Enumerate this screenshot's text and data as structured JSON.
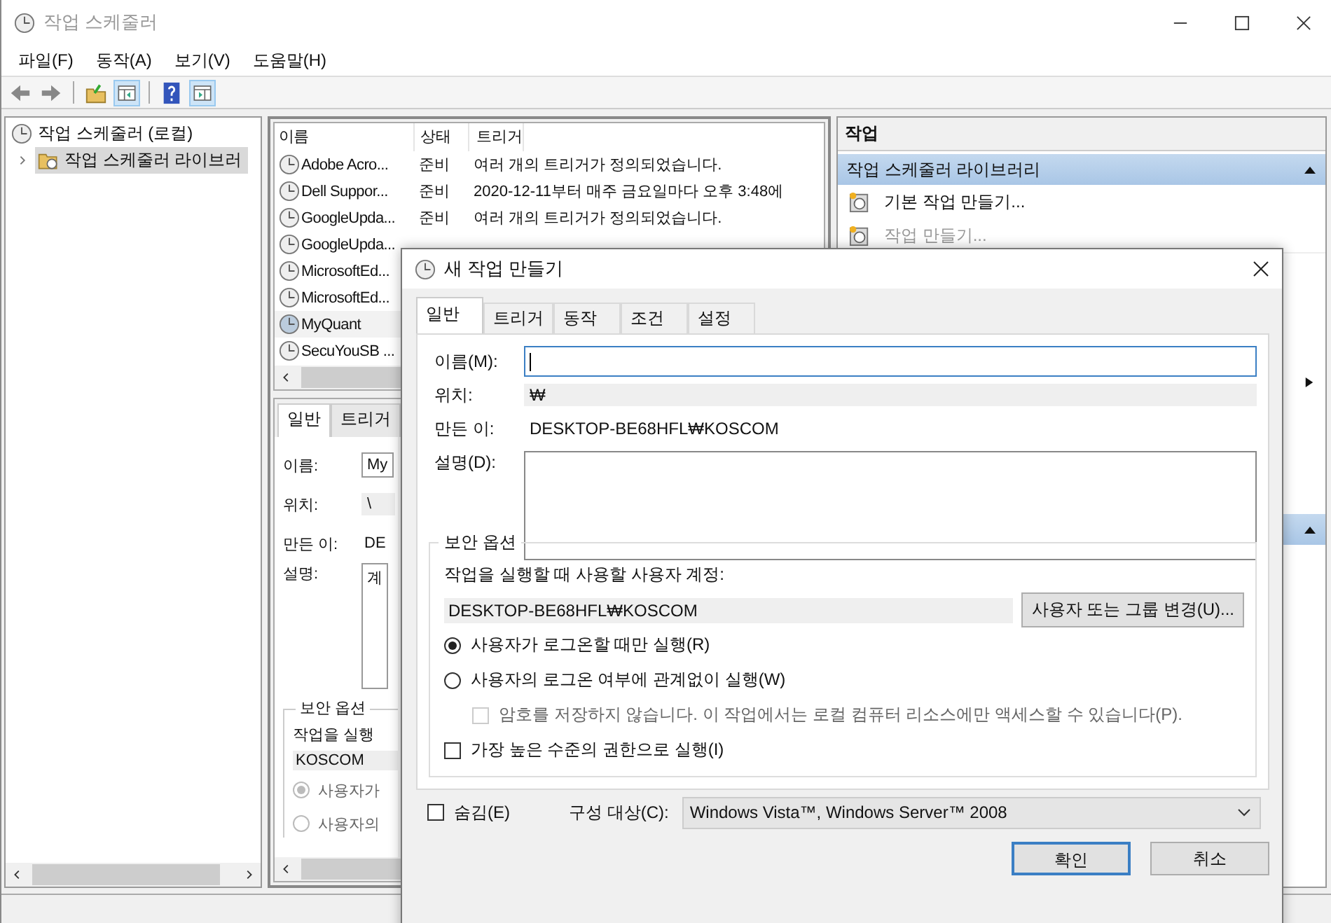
{
  "window": {
    "title": "작업 스케줄러"
  },
  "menu": [
    "파일(F)",
    "동작(A)",
    "보기(V)",
    "도움말(H)"
  ],
  "tree": [
    {
      "label": "작업 스케줄러 (로컬)",
      "selected": false,
      "children": [
        {
          "label": "작업 스케줄러 라이브러",
          "selected": true,
          "expanded": false
        }
      ]
    }
  ],
  "task_list": {
    "columns": [
      "이름",
      "상태",
      "트리거"
    ],
    "rows": [
      {
        "name": "Adobe Acro...",
        "status": "준비",
        "trigger": "여러 개의 트리거가 정의되었습니다.",
        "selected": false
      },
      {
        "name": "Dell Suppor...",
        "status": "준비",
        "trigger": "2020-12-11부터 매주 금요일마다 오후 3:48에",
        "selected": false
      },
      {
        "name": "GoogleUpda...",
        "status": "준비",
        "trigger": "여러 개의 트리거가 정의되었습니다.",
        "selected": false
      },
      {
        "name": "GoogleUpda...",
        "selected": false
      },
      {
        "name": "MicrosoftEd...",
        "selected": false
      },
      {
        "name": "MicrosoftEd...",
        "selected": false
      },
      {
        "name": "MyQuant",
        "selected": true
      },
      {
        "name": "SecuYouSB ...",
        "selected": false
      }
    ]
  },
  "detail": {
    "tabs": [
      {
        "label": "일반",
        "selected": true
      },
      {
        "label": "트리거",
        "selected": false
      }
    ],
    "name_label": "이름:",
    "name_value": "My",
    "location_label": "위치:",
    "location_value": "\\",
    "author_label": "만든 이:",
    "author_value": "DE",
    "description_label": "설명:",
    "description_value": "계",
    "security": {
      "legend": "보안 옵션",
      "account_label": "작업을 실행",
      "account": "KOSCOM",
      "options": [
        {
          "label": "사용자가",
          "selected": true
        },
        {
          "label": "사용자의",
          "selected": false
        }
      ]
    }
  },
  "actions": {
    "title": "작업",
    "sections": [
      {
        "title": "작업 스케줄러 라이브러리",
        "expanded": true,
        "items": [
          {
            "label": "기본 작업 만들기...",
            "disabled": false
          },
          {
            "label": "작업 만들기...",
            "disabled": true
          }
        ]
      },
      {
        "expanded": true
      }
    ]
  },
  "dialog": {
    "title": "새 작업 만들기",
    "tabs": [
      {
        "label": "일반",
        "selected": true
      },
      {
        "label": "트리거",
        "selected": false
      },
      {
        "label": "동작",
        "selected": false
      },
      {
        "label": "조건",
        "selected": false
      },
      {
        "label": "설정",
        "selected": false
      }
    ],
    "name_label": "이름(M):",
    "location_label": "위치:",
    "location_value": "₩",
    "author_label": "만든 이:",
    "author_value": "DESKTOP-BE68HFL₩KOSCOM",
    "description_label": "설명(D):",
    "security": {
      "legend": "보안 옵션",
      "account_label": "작업을 실행할 때 사용할 사용자 계정:",
      "account": "DESKTOP-BE68HFL₩KOSCOM",
      "change_button": "사용자 또는 그룹 변경(U)...",
      "options": [
        {
          "label": "사용자가 로그온할 때만 실행(R)",
          "selected": true
        },
        {
          "label": "사용자의 로그온 여부에 관계없이 실행(W)",
          "selected": false,
          "children": [
            {
              "label": "암호를 저장하지 않습니다. 이 작업에서는 로컬 컴퓨터 리소스에만 액세스할 수 있습니다(P).",
              "checked": false,
              "disabled": true
            }
          ]
        }
      ],
      "highest": {
        "label": "가장 높은 수준의 권한으로 실행(I)",
        "checked": false
      }
    },
    "hidden": {
      "label": "숨김(E)",
      "checked": false
    },
    "configure": {
      "label": "구성 대상(C):",
      "value": "Windows Vista™, Windows Server™ 2008"
    },
    "buttons": [
      {
        "label": "확인",
        "default": true
      },
      {
        "label": "취소",
        "default": false
      }
    ]
  }
}
